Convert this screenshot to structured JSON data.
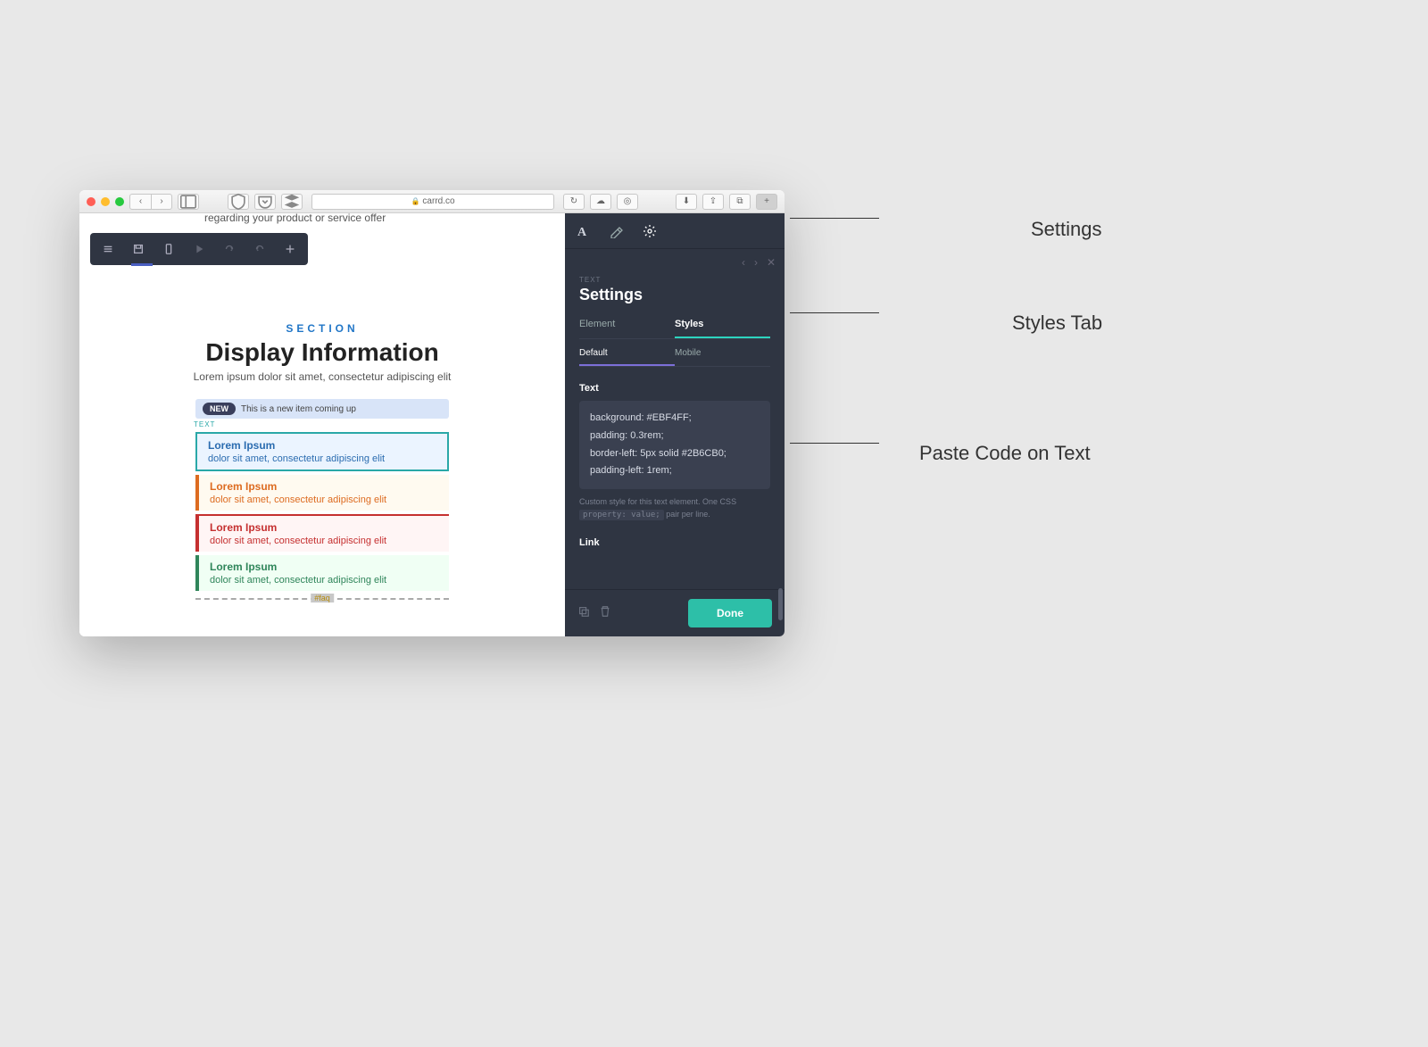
{
  "browser": {
    "url": "carrd.co"
  },
  "canvas": {
    "top_cut_text": "regarding your product or service offer",
    "section_label": "SECTION",
    "section_title": "Display Information",
    "section_sub": "Lorem ipsum dolor sit amet, consectetur adipiscing elit",
    "new_badge": "NEW",
    "new_text": "This is a new item coming up",
    "text_label": "TEXT",
    "boxes": [
      {
        "title": "Lorem Ipsum",
        "sub": "dolor sit amet, consectetur adipiscing elit"
      },
      {
        "title": "Lorem Ipsum",
        "sub": "dolor sit amet, consectetur adipiscing elit"
      },
      {
        "title": "Lorem Ipsum",
        "sub": "dolor sit amet, consectetur adipiscing elit"
      },
      {
        "title": "Lorem Ipsum",
        "sub": "dolor sit amet, consectetur adipiscing elit"
      }
    ],
    "faq_anchor": "#faq"
  },
  "panel": {
    "crumb": "TEXT",
    "title": "Settings",
    "tabs": {
      "element": "Element",
      "styles": "Styles"
    },
    "subtabs": {
      "default": "Default",
      "mobile": "Mobile"
    },
    "text_label": "Text",
    "code": "background: #EBF4FF;\npadding: 0.3rem;\nborder-left: 5px solid #2B6CB0;\npadding-left: 1rem;",
    "help_prefix": "Custom style for this text element. One CSS",
    "help_code": "property: value;",
    "help_suffix": "pair per line.",
    "link_label": "Link",
    "done": "Done"
  },
  "annotations": {
    "settings": "Settings",
    "styles_tab": "Styles Tab",
    "paste_code": "Paste Code on Text"
  }
}
